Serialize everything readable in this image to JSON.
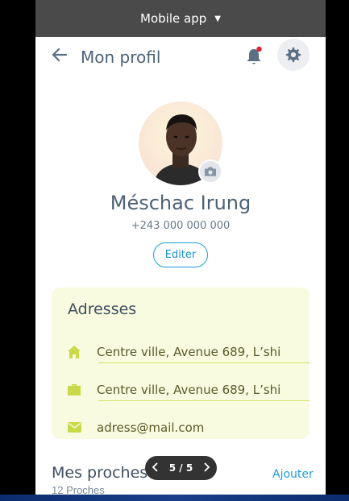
{
  "device": {
    "title": "Mobile app"
  },
  "header": {
    "title": "Mon profil"
  },
  "profile": {
    "name": "Méschac Irung",
    "phone": "+243 000 000 000",
    "edit_label": "Editer"
  },
  "addresses": {
    "title": "Adresses",
    "items": [
      {
        "icon": "home-icon",
        "text": "Centre ville, Avenue 689, L’shi"
      },
      {
        "icon": "briefcase-icon",
        "text": "Centre ville, Avenue 689, L’shi"
      },
      {
        "icon": "mail-icon",
        "text": "adress@mail.com"
      }
    ]
  },
  "relatives": {
    "title": "Mes proches",
    "count_text": "12 Proches",
    "add_label": "Ajouter"
  },
  "pager": {
    "label": "5 / 5"
  },
  "colors": {
    "accent": "#1b9ee0",
    "card_bg": "#f8fbdf",
    "icon_yellow": "#c9d94a",
    "notification": "#e0232e"
  }
}
